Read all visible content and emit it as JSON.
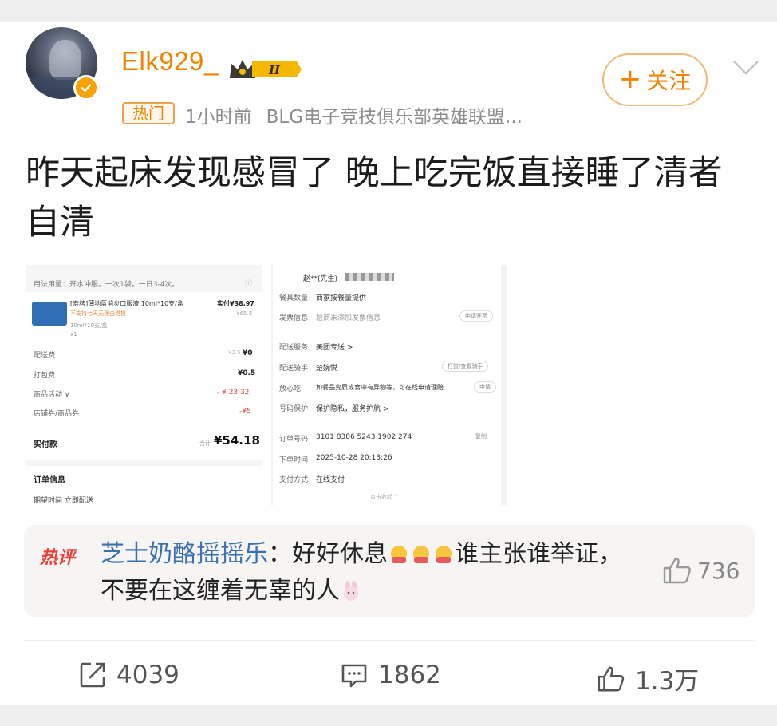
{
  "user": {
    "name": "Elk929_",
    "level_badge": "II"
  },
  "post": {
    "hot_tag": "热门",
    "time": "1小时前",
    "source": "BLG电子竞技俱乐部英雄联盟...",
    "follow_label": "关注",
    "text": "昨天起床发现感冒了 晚上吃完饭直接睡了清者自清"
  },
  "receipt_left": {
    "usage": "用法用量：开水冲服。一次1袋，一日3-4次。",
    "product_name": "[寿牌]薄地蓝消炎口服液 10ml*10支/盒",
    "product_note": "不支持七天无理由退换",
    "product_spec": "10ml*10支/盒",
    "product_qty": "x1",
    "paid_label": "实付¥38.97",
    "orig_price": "¥65.3",
    "rows": [
      {
        "label": "配送费",
        "old": "¥2.5",
        "value": "¥0"
      },
      {
        "label": "打包费",
        "old": "",
        "value": "¥0.5"
      },
      {
        "label": "商品活动 ∨",
        "old": "",
        "value": "- ¥ 23.32"
      },
      {
        "label": "店铺券/商品券",
        "old": "",
        "value": "-¥5"
      }
    ],
    "total_label": "实付款",
    "total_prefix": "合计",
    "total_value": "¥54.18",
    "order_info_title": "订单信息",
    "expect_label": "期望时间",
    "expect_value": "立即配送"
  },
  "receipt_right": {
    "name_masked": "赵**(先生)",
    "rows": [
      {
        "label": "餐具数量",
        "value": "商家按餐量提供",
        "btn": ""
      },
      {
        "label": "发票信息",
        "value": "尬商未添加发票信息",
        "btn": "申请开票"
      },
      {
        "label": "配送服务",
        "value": "美团专送 >",
        "btn": ""
      },
      {
        "label": "配送骑手",
        "value": "楚婉悦",
        "btn": "打赏/查看骑手"
      },
      {
        "label": "放心吃",
        "value": "如餐品变质或食中有异物等，可在线申请理赔",
        "btn": "申请"
      },
      {
        "label": "号码保护",
        "value": "保护隐私，服务护航 >",
        "btn": ""
      },
      {
        "label": "订单号码",
        "value": "3101 8386 5243 1902 274",
        "btn": "复制"
      },
      {
        "label": "下单时间",
        "value": "2025-10-28 20:13:26",
        "btn": ""
      },
      {
        "label": "支付方式",
        "value": "在线支付",
        "btn": ""
      }
    ],
    "collapse": "点击收起 ^"
  },
  "hot_comment": {
    "badge": "热评",
    "author": "芝士奶酪摇摇乐",
    "text_a": "：好好休息",
    "text_b": "谁主张谁举证，不要在这缠着无辜的人",
    "likes": "736"
  },
  "actions": {
    "forward_count": "4039",
    "comment_count": "1862",
    "like_count": "1.3万"
  },
  "colors": {
    "accent": "#f08300",
    "link": "#3a6fb2",
    "hot_red": "#e8413a"
  }
}
